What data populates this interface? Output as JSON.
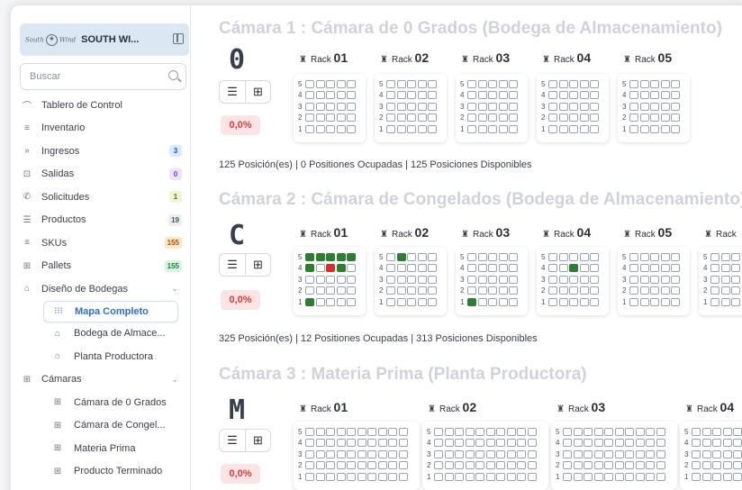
{
  "brand": {
    "logo_text": "South",
    "logo_text2": "Wind",
    "name": "SOUTH WI..."
  },
  "search": {
    "placeholder": "Buscar"
  },
  "nav": [
    {
      "icon": "gauge-icon",
      "glyph": "⌒",
      "label": "Tablero de Control"
    },
    {
      "icon": "list-icon",
      "glyph": "≡",
      "label": "Inventario"
    },
    {
      "icon": "chevrons-right-icon",
      "glyph": "»",
      "label": "Ingresos",
      "badge": "3",
      "badge_bg": "#dbeafe",
      "badge_fg": "#1d4ed8"
    },
    {
      "icon": "truck-icon",
      "glyph": "⊡",
      "label": "Salidas",
      "badge": "0",
      "badge_bg": "#ede4fb",
      "badge_fg": "#7c3aed"
    },
    {
      "icon": "phone-icon",
      "glyph": "✆",
      "label": "Solicitudes",
      "badge": "1",
      "badge_bg": "#ecf7d6",
      "badge_fg": "#4d7c0f"
    },
    {
      "icon": "list-numbered-icon",
      "glyph": "☰",
      "label": "Productos",
      "badge": "19",
      "badge_bg": "#eceef1",
      "badge_fg": "#4b5563"
    },
    {
      "icon": "list-icon",
      "glyph": "≡",
      "label": "SKUs",
      "badge": "155",
      "badge_bg": "#fde6c8",
      "badge_fg": "#b45309"
    },
    {
      "icon": "boxes-icon",
      "glyph": "⊞",
      "label": "Pallets",
      "badge": "155",
      "badge_bg": "#d9f5e0",
      "badge_fg": "#15803d"
    },
    {
      "icon": "warehouse-icon",
      "glyph": "⌂",
      "label": "Diseño de Bodegas",
      "expanded": true
    },
    {
      "icon": "grid-dots-icon",
      "glyph": "⁝⁝⁝",
      "label": "Mapa Completo",
      "sub": true,
      "active": true
    },
    {
      "icon": "warehouse-icon",
      "glyph": "⌂",
      "label": "Bodega de Almace...",
      "sub": true
    },
    {
      "icon": "warehouse-icon",
      "glyph": "⌂",
      "label": "Planta Productora",
      "sub": true
    },
    {
      "icon": "table-icon",
      "glyph": "⊞",
      "label": "Cámaras",
      "expanded": true
    },
    {
      "icon": "table-icon",
      "glyph": "⊞",
      "label": "Cámara de 0 Grados",
      "sub": true
    },
    {
      "icon": "table-icon",
      "glyph": "⊞",
      "label": "Cámara de Congel...",
      "sub": true
    },
    {
      "icon": "table-icon",
      "glyph": "⊞",
      "label": "Materia Prima",
      "sub": true
    },
    {
      "icon": "table-icon",
      "glyph": "⊞",
      "label": "Producto Terminado",
      "sub": true
    }
  ],
  "sections": [
    {
      "title": "Cámara 1 : Cámara de 0 Grados (Bodega de Almacenamiento)",
      "letter": "0",
      "percent": "0,0%",
      "summary": "125 Posición(es) | 0 Positiones Ocupadas | 125 Posiciones Disponibles",
      "rack_prefix": "Rack",
      "racks": [
        {
          "number": "01",
          "rows": [
            [
              0,
              0,
              0,
              0,
              0
            ],
            [
              0,
              0,
              0,
              0,
              0
            ],
            [
              0,
              0,
              0,
              0,
              0
            ],
            [
              0,
              0,
              0,
              0,
              0
            ],
            [
              0,
              0,
              0,
              0,
              0
            ]
          ]
        },
        {
          "number": "02",
          "rows": [
            [
              0,
              0,
              0,
              0,
              0
            ],
            [
              0,
              0,
              0,
              0,
              0
            ],
            [
              0,
              0,
              0,
              0,
              0
            ],
            [
              0,
              0,
              0,
              0,
              0
            ],
            [
              0,
              0,
              0,
              0,
              0
            ]
          ]
        },
        {
          "number": "03",
          "rows": [
            [
              0,
              0,
              0,
              0,
              0
            ],
            [
              0,
              0,
              0,
              0,
              0
            ],
            [
              0,
              0,
              0,
              0,
              0
            ],
            [
              0,
              0,
              0,
              0,
              0
            ],
            [
              0,
              0,
              0,
              0,
              0
            ]
          ]
        },
        {
          "number": "04",
          "rows": [
            [
              0,
              0,
              0,
              0,
              0
            ],
            [
              0,
              0,
              0,
              0,
              0
            ],
            [
              0,
              0,
              0,
              0,
              0
            ],
            [
              0,
              0,
              0,
              0,
              0
            ],
            [
              0,
              0,
              0,
              0,
              0
            ]
          ]
        },
        {
          "number": "05",
          "rows": [
            [
              0,
              0,
              0,
              0,
              0
            ],
            [
              0,
              0,
              0,
              0,
              0
            ],
            [
              0,
              0,
              0,
              0,
              0
            ],
            [
              0,
              0,
              0,
              0,
              0
            ],
            [
              0,
              0,
              0,
              0,
              0
            ]
          ]
        }
      ]
    },
    {
      "title": "Cámara 2 : Cámara de Congelados (Bodega de Almacenamiento)",
      "letter": "C",
      "percent": "0,0%",
      "summary": "325 Posición(es) | 12 Positiones Ocupadas | 313 Posiciones Disponibles",
      "rack_prefix": "Rack",
      "racks": [
        {
          "number": "01",
          "rows": [
            [
              1,
              1,
              1,
              1,
              1
            ],
            [
              1,
              0,
              2,
              1,
              0
            ],
            [
              0,
              0,
              0,
              0,
              0
            ],
            [
              0,
              0,
              0,
              0,
              0
            ],
            [
              1,
              0,
              0,
              0,
              0
            ]
          ]
        },
        {
          "number": "02",
          "rows": [
            [
              0,
              1,
              0,
              0,
              0
            ],
            [
              0,
              0,
              0,
              0,
              0
            ],
            [
              0,
              0,
              0,
              0,
              0
            ],
            [
              0,
              0,
              0,
              0,
              0
            ],
            [
              0,
              0,
              0,
              0,
              0
            ]
          ]
        },
        {
          "number": "03",
          "rows": [
            [
              0,
              0,
              0,
              0,
              0
            ],
            [
              0,
              0,
              0,
              0,
              0
            ],
            [
              0,
              0,
              0,
              0,
              0
            ],
            [
              0,
              0,
              0,
              0,
              0
            ],
            [
              1,
              0,
              0,
              0,
              0
            ]
          ]
        },
        {
          "number": "04",
          "rows": [
            [
              0,
              0,
              0,
              0,
              0
            ],
            [
              0,
              0,
              1,
              0,
              0
            ],
            [
              0,
              0,
              0,
              0,
              0
            ],
            [
              0,
              0,
              0,
              0,
              0
            ],
            [
              0,
              0,
              0,
              0,
              0
            ]
          ]
        },
        {
          "number": "05",
          "rows": [
            [
              0,
              0,
              0,
              0,
              0
            ],
            [
              0,
              0,
              0,
              0,
              0
            ],
            [
              0,
              0,
              0,
              0,
              0
            ],
            [
              0,
              0,
              0,
              0,
              0
            ],
            [
              0,
              0,
              0,
              0,
              0
            ]
          ]
        },
        {
          "number": "",
          "rows": [
            [
              0,
              0,
              0,
              0,
              0
            ],
            [
              0,
              0,
              0,
              0,
              0
            ],
            [
              0,
              0,
              0,
              0,
              0
            ],
            [
              0,
              0,
              0,
              0,
              0
            ],
            [
              0,
              0,
              0,
              0,
              0
            ]
          ]
        }
      ]
    },
    {
      "title": "Cámara 3 : Materia Prima (Planta Productora)",
      "letter": "M",
      "percent": "0,0%",
      "summary": "",
      "rack_prefix": "Rack",
      "racks": [
        {
          "number": "01",
          "rows": [
            [
              0,
              0,
              0,
              0,
              0,
              0,
              0,
              0,
              0,
              0
            ],
            [
              0,
              0,
              0,
              0,
              0,
              0,
              0,
              0,
              0,
              0
            ],
            [
              0,
              0,
              0,
              0,
              0,
              0,
              0,
              0,
              0,
              0
            ],
            [
              0,
              0,
              0,
              0,
              0,
              0,
              0,
              0,
              0,
              0
            ],
            [
              0,
              0,
              0,
              0,
              0,
              0,
              0,
              0,
              0,
              0
            ]
          ]
        },
        {
          "number": "02",
          "rows": [
            [
              0,
              0,
              0,
              0,
              0,
              0,
              0,
              0,
              0,
              0
            ],
            [
              0,
              0,
              0,
              0,
              0,
              0,
              0,
              0,
              0,
              0
            ],
            [
              0,
              0,
              0,
              0,
              0,
              0,
              0,
              0,
              0,
              0
            ],
            [
              0,
              0,
              0,
              0,
              0,
              0,
              0,
              0,
              0,
              0
            ],
            [
              0,
              0,
              0,
              0,
              0,
              0,
              0,
              0,
              0,
              0
            ]
          ]
        },
        {
          "number": "03",
          "rows": [
            [
              0,
              0,
              0,
              0,
              0,
              0,
              0,
              0,
              0,
              0
            ],
            [
              0,
              0,
              0,
              0,
              0,
              0,
              0,
              0,
              0,
              0
            ],
            [
              0,
              0,
              0,
              0,
              0,
              0,
              0,
              0,
              0,
              0
            ],
            [
              0,
              0,
              0,
              0,
              0,
              0,
              0,
              0,
              0,
              0
            ],
            [
              0,
              0,
              0,
              0,
              0,
              0,
              0,
              0,
              0,
              0
            ]
          ]
        },
        {
          "number": "04",
          "rows": [
            [
              0,
              0,
              0,
              0,
              0,
              0,
              0,
              0,
              0,
              0
            ],
            [
              0,
              0,
              0,
              0,
              0,
              0,
              0,
              0,
              0,
              0
            ],
            [
              0,
              0,
              0,
              0,
              0,
              0,
              0,
              0,
              0,
              0
            ],
            [
              0,
              0,
              0,
              0,
              0,
              0,
              0,
              0,
              0,
              0
            ],
            [
              0,
              0,
              0,
              0,
              0,
              0,
              0,
              0,
              0,
              0
            ]
          ]
        }
      ]
    }
  ],
  "view_toggle": {
    "list_icon": "list-icon",
    "grid_icon": "grid-icon"
  },
  "colors": {
    "occupied": "#2e7d32",
    "blocked": "#d32f2f",
    "percent_bg": "#fde4e4",
    "percent_fg": "#d63b3b"
  }
}
